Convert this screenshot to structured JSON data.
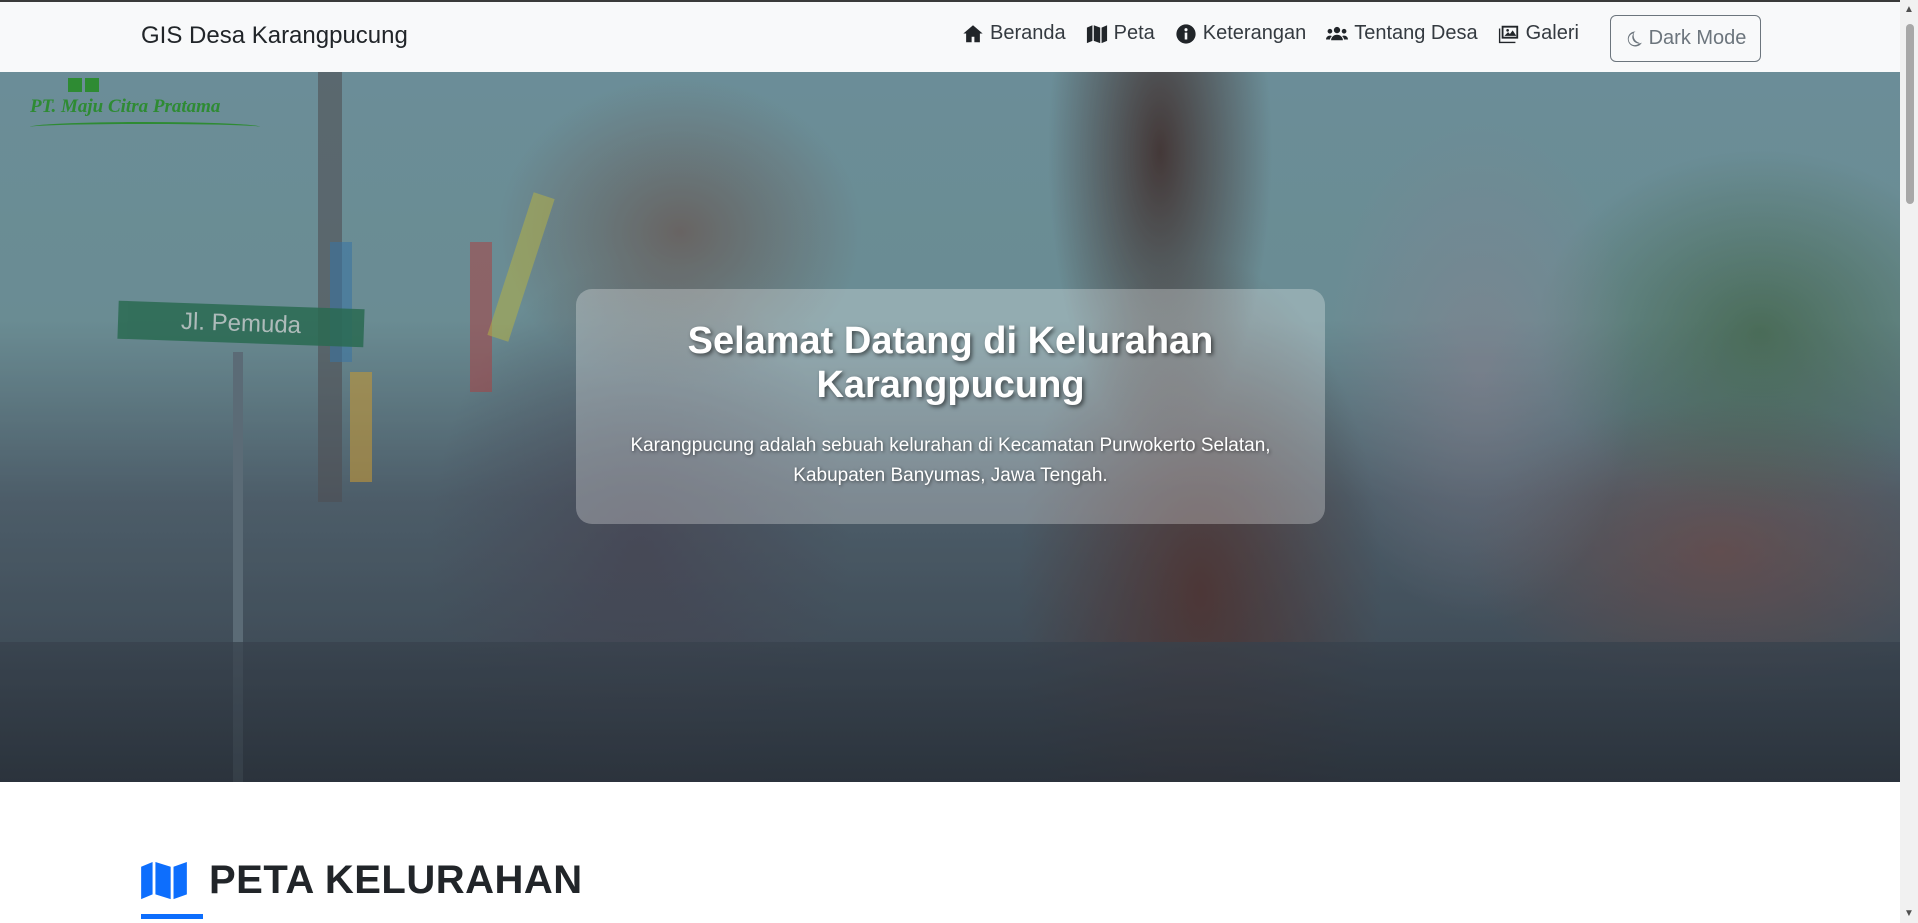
{
  "navbar": {
    "brand": "GIS Desa Karangpucung",
    "links": [
      {
        "label": "Beranda",
        "icon": "home-icon"
      },
      {
        "label": "Peta",
        "icon": "map-icon"
      },
      {
        "label": "Keterangan",
        "icon": "info-circle-icon"
      },
      {
        "label": "Tentang Desa",
        "icon": "users-icon"
      },
      {
        "label": "Galeri",
        "icon": "images-icon"
      }
    ],
    "dark_mode_label": "Dark Mode"
  },
  "hero": {
    "logo_text": "PT. Maju Citra Pratama",
    "street_sign": "Jl. Pemuda",
    "title": "Selamat Datang di Kelurahan Karangpucung",
    "description": "Karangpucung adalah sebuah kelurahan di Kecamatan Purwokerto Selatan, Kabupaten Banyumas, Jawa Tengah."
  },
  "section": {
    "title": "PETA KELURAHAN",
    "icon": "map-icon",
    "accent_color": "#0d6efd"
  }
}
